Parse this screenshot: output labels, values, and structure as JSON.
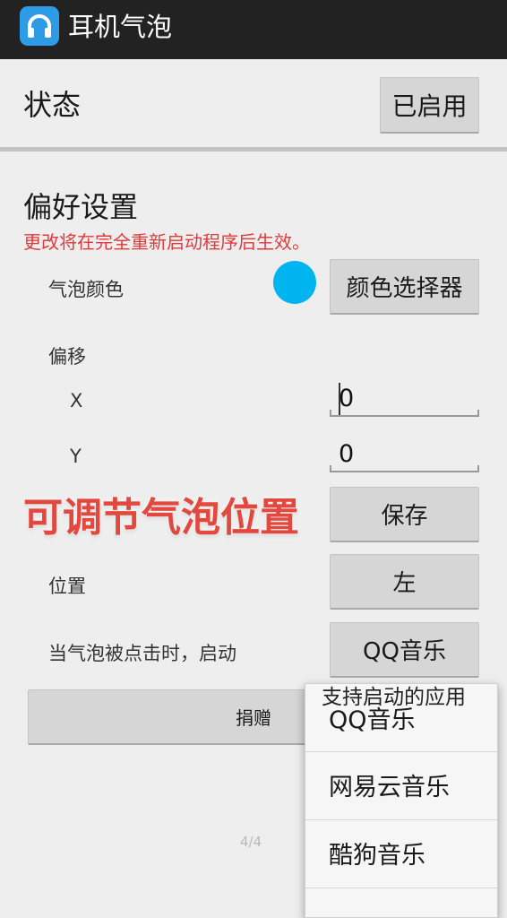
{
  "title_bar": {
    "app_title": "耳机气泡",
    "icon": "headphones-icon"
  },
  "status": {
    "label": "状态",
    "button": "已启用"
  },
  "preferences": {
    "title": "偏好设置",
    "note": "更改将在完全重新启动程序后生效。",
    "bubble_color": {
      "label": "气泡颜色",
      "swatch_color": "#00b4ef",
      "button": "颜色选择器"
    },
    "offset": {
      "label": "偏移",
      "x_label": "X",
      "x_value": "0",
      "y_label": "Y",
      "y_value": "0"
    },
    "overlay_caption": "可调节气泡位置",
    "save_button": "保存",
    "position": {
      "label": "位置",
      "button": "左"
    },
    "on_click": {
      "label": "当气泡被点击时，启动",
      "button": "QQ音乐"
    },
    "donate_button": "捐赠"
  },
  "pager": "4/4",
  "popup": {
    "header": "支持启动的应用",
    "items": [
      "QQ音乐",
      "网易云音乐",
      "酷狗音乐"
    ]
  },
  "colors": {
    "accent_red": "#e23a3a",
    "titlebar": "#222222",
    "swatch": "#00b4ef"
  }
}
